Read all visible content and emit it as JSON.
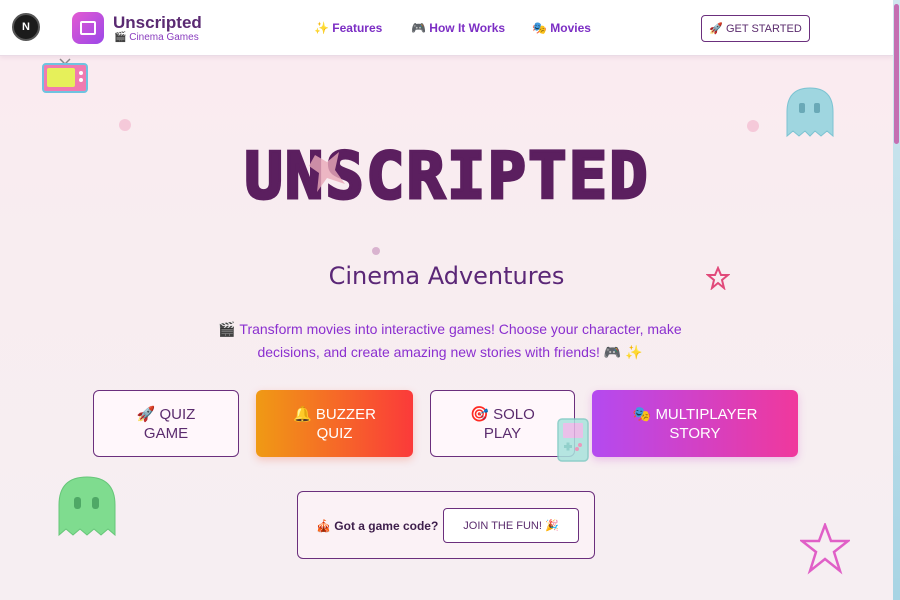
{
  "header": {
    "framework_badge": "N",
    "brand_title": "Unscripted",
    "brand_subtitle": "🎬 Cinema Games",
    "nav": [
      {
        "label": "✨ Features"
      },
      {
        "label": "🎮 How It Works"
      },
      {
        "label": "🎭 Movies"
      }
    ],
    "cta_label": "🚀 GET STARTED"
  },
  "hero": {
    "title": "UNSCRIPTED",
    "subtitle": "Cinema Adventures",
    "description_line1": "🎬 Transform movies into interactive games! Choose your character, make",
    "description_line2": "decisions, and create amazing new stories with friends! 🎮 ✨"
  },
  "modes": [
    {
      "line1": "🚀 QUIZ",
      "line2": "GAME"
    },
    {
      "line1": "🔔 BUZZER",
      "line2": "QUIZ"
    },
    {
      "line1": "🎯 SOLO",
      "line2": "PLAY"
    },
    {
      "line1": "🎭 MULTIPLAYER",
      "line2": "STORY"
    }
  ],
  "join": {
    "label": "🎪 Got a game code?",
    "button_label": "JOIN THE FUN! 🎉"
  },
  "colors": {
    "brand_purple": "#5a2a72",
    "accent_violet": "#8b2fcf",
    "buzzer_gradient": [
      "#f09a14",
      "#fb3a3a"
    ],
    "multiplayer_gradient": [
      "#b44af0",
      "#f0389c"
    ]
  },
  "decorations": [
    "tv-icon",
    "ghost-icon",
    "star-icon",
    "gameboy-icon"
  ]
}
